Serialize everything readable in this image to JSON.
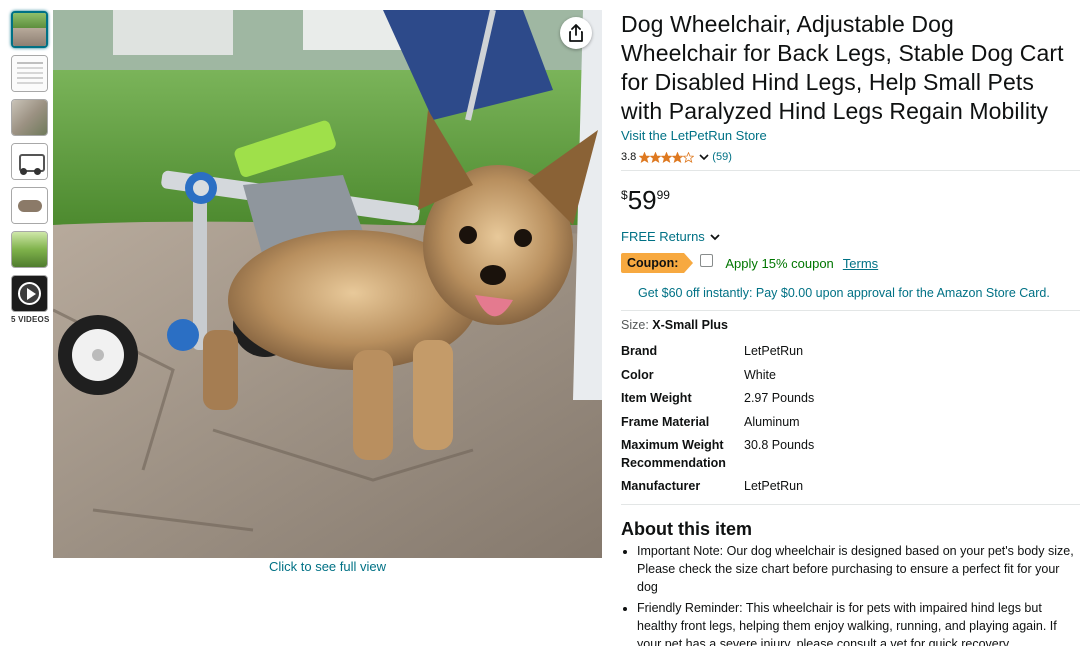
{
  "thumbnails": {
    "videos_label": "5 VIDEOS"
  },
  "image": {
    "full_view_link": "Click to see full view"
  },
  "product": {
    "title": "Dog Wheelchair, Adjustable Dog Wheelchair for Back Legs, Stable Dog Cart for Disabled Hind Legs, Help Small Pets with Paralyzed Hind Legs Regain Mobility",
    "store_link": "Visit the LetPetRun Store",
    "rating_value": "3.8",
    "rating_stars": 3.8,
    "review_count": "(59)",
    "price": {
      "currency": "$",
      "whole": "59",
      "fraction": "99"
    },
    "returns_label": "FREE Returns",
    "coupon": {
      "badge": "Coupon:",
      "apply_text": "Apply 15% coupon",
      "terms": "Terms"
    },
    "store_card_offer": "Get $60 off instantly: Pay $0.00 upon approval for the Amazon Store Card.",
    "size": {
      "label": "Size:",
      "value": "X-Small Plus"
    },
    "specs": [
      {
        "key": "Brand",
        "value": "LetPetRun"
      },
      {
        "key": "Color",
        "value": "White"
      },
      {
        "key": "Item Weight",
        "value": "2.97 Pounds"
      },
      {
        "key": "Frame Material",
        "value": "Aluminum"
      },
      {
        "key": "Maximum Weight Recommendation",
        "value": "30.8 Pounds"
      },
      {
        "key": "Manufacturer",
        "value": "LetPetRun"
      }
    ],
    "about": {
      "title": "About this item",
      "bullets": [
        "Important Note: Our dog wheelchair is designed based on your pet's body size, Please check the size chart before purchasing to ensure a perfect fit for your dog",
        "Friendly Reminder: This wheelchair is for pets with impaired hind legs but healthy front legs, helping them enjoy walking, running, and playing again. If your pet has a severe injury, please consult a vet for quick recovery"
      ]
    }
  },
  "colors": {
    "link": "#007185",
    "star": "#de7921",
    "coupon_badge": "#f7a940",
    "coupon_text": "#007600"
  }
}
